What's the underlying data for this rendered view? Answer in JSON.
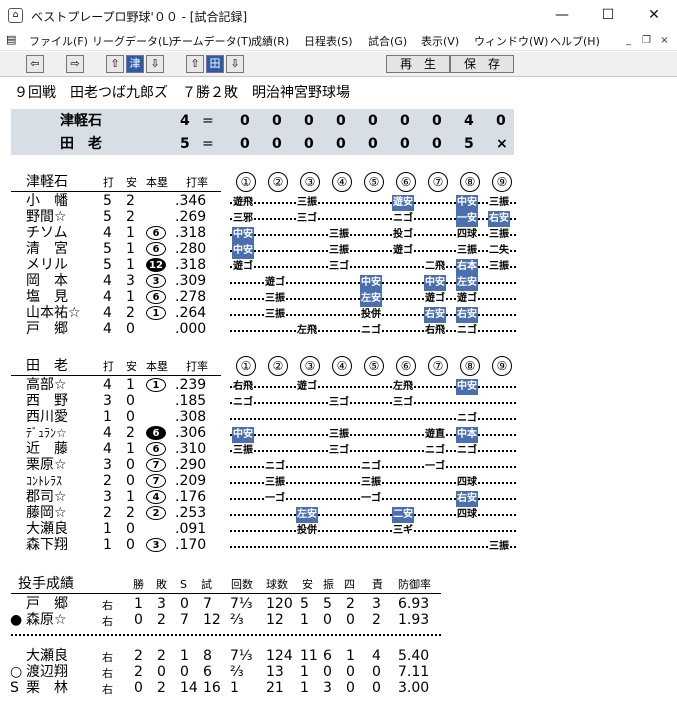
{
  "window": {
    "title": "ベストプレープロ野球'００ - [試合記録]",
    "icon": "baseball-cap-icon"
  },
  "menu": [
    "ファイル(F)",
    "リーグデータ(L)",
    "チームデータ(T)",
    "成績(R)",
    "日程表(S)",
    "試合(G)",
    "表示(V)",
    "ウィンドウ(W)",
    "ヘルプ(H)"
  ],
  "toolbar": {
    "team1": "津",
    "team2": "田",
    "play": "再　生",
    "save": "保　存"
  },
  "game_info": "９回戦　田老つば九郎ズ　７勝２敗　明治神宮野球場",
  "scoreboard": [
    {
      "team": "津軽石",
      "score": "4",
      "eq": "=",
      "innings": [
        "0",
        "0",
        "0",
        "0",
        "0",
        "0",
        "0",
        "4",
        "0"
      ]
    },
    {
      "team": "田　老",
      "score": "5",
      "eq": "=",
      "innings": [
        "0",
        "0",
        "0",
        "0",
        "0",
        "0",
        "0",
        "5",
        "×"
      ]
    }
  ],
  "headers": {
    "ab": "打",
    "h": "安",
    "hr": "本塁",
    "avg": "打率",
    "inn": [
      "①",
      "②",
      "③",
      "④",
      "⑤",
      "⑥",
      "⑦",
      "⑧",
      "⑨"
    ]
  },
  "team1": {
    "name": "津軽石",
    "players": [
      {
        "name": "小　幡",
        "ab": "5",
        "h": "2",
        "hr": "",
        "avg": ".346"
      },
      {
        "name": "野間☆",
        "ab": "5",
        "h": "2",
        "hr": "",
        "avg": ".269"
      },
      {
        "name": "チソム",
        "ab": "4",
        "h": "1",
        "hr": "6",
        "avg": ".318"
      },
      {
        "name": "清　宮",
        "ab": "5",
        "h": "1",
        "hr": "6",
        "avg": ".280"
      },
      {
        "name": "メリル",
        "ab": "5",
        "h": "1",
        "hr": "12",
        "avg": ".318"
      },
      {
        "name": "岡　本",
        "ab": "4",
        "h": "3",
        "hr": "3",
        "avg": ".309"
      },
      {
        "name": "塩　見",
        "ab": "4",
        "h": "1",
        "hr": "6",
        "avg": ".278"
      },
      {
        "name": "山本祐☆",
        "ab": "4",
        "h": "2",
        "hr": "1",
        "avg": ".264"
      },
      {
        "name": "戸　郷",
        "ab": "4",
        "h": "0",
        "hr": "",
        "avg": ".000"
      }
    ]
  },
  "team2": {
    "name": "田　老",
    "players": [
      {
        "name": "高部☆",
        "ab": "4",
        "h": "1",
        "hr": "1",
        "avg": ".239"
      },
      {
        "name": "西　野",
        "ab": "3",
        "h": "0",
        "hr": "",
        "avg": ".185"
      },
      {
        "name": "西川愛",
        "ab": "1",
        "h": "0",
        "hr": "",
        "avg": ".308"
      },
      {
        "name": "ﾃﾞｭﾗﾝ☆",
        "ab": "4",
        "h": "2",
        "hr": "6",
        "avg": ".306"
      },
      {
        "name": "近　藤",
        "ab": "4",
        "h": "1",
        "hr": "6",
        "avg": ".310"
      },
      {
        "name": "栗原☆",
        "ab": "3",
        "h": "0",
        "hr": "7",
        "avg": ".290"
      },
      {
        "name": "ｺﾝﾄﾚﾗｽ",
        "ab": "2",
        "h": "0",
        "hr": "7",
        "avg": ".209"
      },
      {
        "name": "郡司☆",
        "ab": "3",
        "h": "1",
        "hr": "4",
        "avg": ".176"
      },
      {
        "name": "藤岡☆",
        "ab": "2",
        "h": "2",
        "hr": "2",
        "avg": ".253"
      },
      {
        "name": "大瀬良",
        "ab": "1",
        "h": "0",
        "hr": "",
        "avg": ".091"
      },
      {
        "name": "森下翔",
        "ab": "1",
        "h": "0",
        "hr": "3",
        "avg": ".170"
      }
    ]
  },
  "pitching": {
    "title": "投手成績",
    "headers": [
      "勝",
      "敗",
      "S",
      "試",
      "回数",
      "球数",
      "安",
      "振",
      "四",
      "責",
      "防御率"
    ],
    "team1": [
      {
        "mark": "",
        "name": "戸　郷",
        "hand": "右",
        "w": "1",
        "l": "3",
        "s": "0",
        "g": "7",
        "ip": "7⅓",
        "np": "120",
        "h": "5",
        "so": "5",
        "bb": "2",
        "er": "3",
        "era": "6.93"
      },
      {
        "mark": "●",
        "name": "森原☆",
        "hand": "右",
        "w": "0",
        "l": "2",
        "s": "7",
        "g": "12",
        "ip": "⅔",
        "np": "12",
        "h": "1",
        "so": "0",
        "bb": "0",
        "er": "2",
        "era": "1.93"
      }
    ],
    "team2": [
      {
        "mark": "",
        "name": "大瀬良",
        "hand": "右",
        "w": "2",
        "l": "2",
        "s": "1",
        "g": "8",
        "ip": "7⅓",
        "np": "124",
        "h": "11",
        "so": "6",
        "bb": "1",
        "er": "4",
        "era": "5.40"
      },
      {
        "mark": "○",
        "name": "渡辺翔",
        "hand": "右",
        "w": "2",
        "l": "0",
        "s": "0",
        "g": "6",
        "ip": "⅔",
        "np": "13",
        "h": "1",
        "so": "0",
        "bb": "0",
        "er": "0",
        "era": "7.11"
      },
      {
        "mark": "S",
        "name": "栗　林",
        "hand": "右",
        "w": "0",
        "l": "2",
        "s": "14",
        "g": "16",
        "ip": "1",
        "np": "21",
        "h": "1",
        "so": "3",
        "bb": "0",
        "er": "0",
        "era": "3.00"
      }
    ]
  },
  "pbp1": [
    [
      [
        "遊飛",
        0
      ],
      [
        "三振",
        2
      ],
      [
        "遊安",
        5
      ],
      [
        "中安",
        7
      ],
      [
        "三振",
        8
      ]
    ],
    [
      [
        "三邪",
        0
      ],
      [
        "三ゴ",
        2
      ],
      [
        "ニゴ",
        5
      ],
      [
        "一安",
        7
      ],
      [
        "右安",
        8
      ]
    ],
    [
      [
        "中安",
        0
      ],
      [
        "三振",
        3
      ],
      [
        "投ゴ",
        5
      ],
      [
        "四球",
        7
      ],
      [
        "三振",
        8
      ]
    ],
    [
      [
        "中安",
        0
      ],
      [
        "三振",
        3
      ],
      [
        "遊ゴ",
        5
      ],
      [
        "三振",
        7
      ],
      [
        "二失",
        8
      ]
    ],
    [
      [
        "遊ゴ",
        0
      ],
      [
        "三ゴ",
        3
      ],
      [
        "二飛",
        6
      ],
      [
        "右本",
        7
      ],
      [
        "三振",
        8
      ]
    ],
    [
      [
        "遊ゴ",
        1
      ],
      [
        "中安",
        4
      ],
      [
        "中安",
        6
      ],
      [
        "左安",
        7
      ]
    ],
    [
      [
        "三振",
        1
      ],
      [
        "左安",
        4
      ],
      [
        "遊ゴ",
        6
      ],
      [
        "遊ゴ",
        7
      ]
    ],
    [
      [
        "三振",
        1
      ],
      [
        "投併",
        4
      ],
      [
        "右安",
        6
      ],
      [
        "右安",
        7
      ]
    ],
    [
      [
        "左飛",
        2
      ],
      [
        "ニゴ",
        4
      ],
      [
        "右飛",
        6
      ],
      [
        "ニゴ",
        7
      ]
    ]
  ],
  "pbp1_hits": [
    "遊安",
    "中安",
    "一安",
    "右安",
    "右本",
    "左安"
  ],
  "pbp2": [
    [
      [
        "右飛",
        0
      ],
      [
        "遊ゴ",
        2
      ],
      [
        "左飛",
        5
      ],
      [
        "中安",
        7
      ]
    ],
    [
      [
        "ニゴ",
        0
      ],
      [
        "三ゴ",
        3
      ],
      [
        "三ゴ",
        5
      ]
    ],
    [
      [
        "ニゴ",
        7
      ]
    ],
    [
      [
        "中安",
        0
      ],
      [
        "三振",
        3
      ],
      [
        "遊直",
        6
      ],
      [
        "中本",
        7
      ]
    ],
    [
      [
        "三振",
        0
      ],
      [
        "三ゴ",
        3
      ],
      [
        "ニゴ",
        6
      ],
      [
        "ニゴ",
        7
      ]
    ],
    [
      [
        "ニゴ",
        1
      ],
      [
        "ニゴ",
        4
      ],
      [
        "一ゴ",
        6
      ]
    ],
    [
      [
        "三振",
        1
      ],
      [
        "三振",
        4
      ],
      [
        "四球",
        7
      ]
    ],
    [
      [
        "一ゴ",
        1
      ],
      [
        "一ゴ",
        4
      ],
      [
        "右安",
        7
      ]
    ],
    [
      [
        "左安",
        2
      ],
      [
        "二安",
        5
      ],
      [
        "四球",
        7
      ]
    ],
    [
      [
        "投併",
        2
      ],
      [
        "三ギ",
        5
      ]
    ],
    [
      [
        "三振",
        8
      ]
    ]
  ],
  "pbp2_hits": [
    "中安",
    "中本",
    "左安",
    "二安",
    "右安"
  ]
}
